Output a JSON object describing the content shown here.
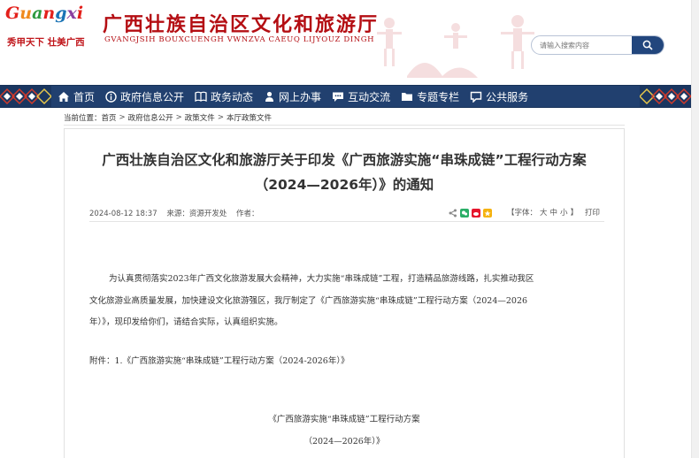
{
  "header": {
    "logo_letters": [
      "G",
      "u",
      "a",
      "n",
      "g",
      "x",
      "i"
    ],
    "logo_colors": [
      "#e3201b",
      "#f08a1c",
      "#2e9a3e",
      "#e3201b",
      "#1a73b5",
      "#8b3ea0",
      "#e3201b"
    ],
    "logo_slogan": "秀甲天下  壮美广西",
    "title": "广西壮族自治区文化和旅游厅",
    "subtitle": "GVANGJSIH BOUXCUENGH VWNZVA CAEUQ LIJYOUZ DINGH",
    "search_placeholder": "请输入搜索内容",
    "search_icon": "search-icon"
  },
  "nav": {
    "items": [
      {
        "label": "首页",
        "icon": "home-icon"
      },
      {
        "label": "政府信息公开",
        "icon": "info-icon"
      },
      {
        "label": "政务动态",
        "icon": "book-icon"
      },
      {
        "label": "网上办事",
        "icon": "person-icon"
      },
      {
        "label": "互动交流",
        "icon": "chat-icon"
      },
      {
        "label": "专题专栏",
        "icon": "folder-icon"
      },
      {
        "label": "公共服务",
        "icon": "chat-bubble-icon"
      }
    ]
  },
  "breadcrumb": {
    "prefix": "当前位置：",
    "items": [
      "首页",
      "政府信息公开",
      "政策文件",
      "本厅政策文件"
    ],
    "separator": ">"
  },
  "article": {
    "title_line1": "广西壮族自治区文化和旅游厅关于印发《广西旅游实施“串珠成链”工程行动方案",
    "title_line2": "（2024—2026年）》的通知",
    "date": "2024-08-12 18:37",
    "source": "来源：资源开发处",
    "author": "作者：",
    "font_label": "【字体：",
    "font_sizes": [
      "大",
      "中",
      "小"
    ],
    "font_end": "】",
    "print": "打印",
    "body_line1": "为认真贯彻落实2023年广西文化旅游发展大会精神，大力实施“串珠成链”工程，打造精品旅游线路，扎实推动我区",
    "body_line2": "文化旅游业高质量发展，加快建设文化旅游强区，我厅制定了《广西旅游实施“串珠成链”工程行动方案（2024—2026",
    "body_line3": "年）》，现印发给你们，请结合实际，认真组织实施。",
    "attachment": "附件：1.《广西旅游实施“串珠成链”工程行动方案（2024-2026年）》",
    "plan_title": "《广西旅游实施“串珠成链”工程行动方案",
    "plan_sub": "（2024—2026年）》"
  },
  "colors": {
    "nav_bg": "#21406f",
    "title_red": "#b40e13",
    "search_btn": "#22467d"
  }
}
